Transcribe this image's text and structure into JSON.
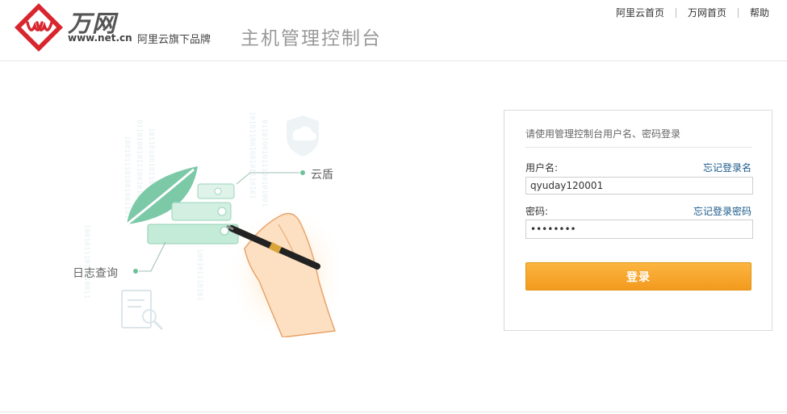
{
  "header": {
    "brand_name": "万网",
    "brand_url": "www.net.cn",
    "brand_sub": "阿里云旗下品牌",
    "console_title": "主机管理控制台",
    "nav": [
      {
        "label": "阿里云首页"
      },
      {
        "label": "万网首页"
      },
      {
        "label": "帮助"
      }
    ]
  },
  "illustration": {
    "label_shield": "云盾",
    "label_log": "日志查询"
  },
  "login": {
    "title": "请使用管理控制台用户名、密码登录",
    "username_label": "用户名:",
    "username_link": "忘记登录名",
    "username_value": "qyuday120001",
    "password_label": "密码:",
    "password_link": "忘记登录密码",
    "password_value": "12345678",
    "submit_label": "登录"
  },
  "colors": {
    "accent": "#f39a1e",
    "link": "#1a5a8a",
    "brand_red": "#d8262f"
  }
}
